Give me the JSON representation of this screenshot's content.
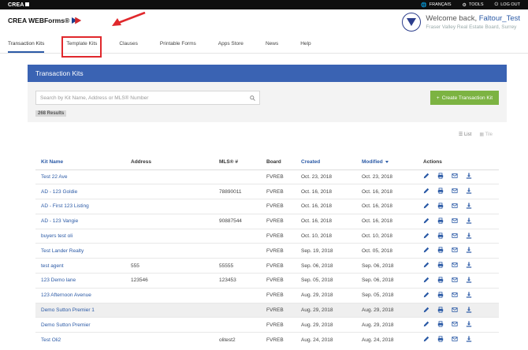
{
  "topbar": {
    "logo": "CREA",
    "links": [
      {
        "icon": "globe-icon",
        "label": "FRANÇAIS"
      },
      {
        "icon": "gear-icon",
        "label": "TOOLS"
      },
      {
        "icon": "power-icon",
        "label": "LOG OUT"
      }
    ]
  },
  "header": {
    "brand": "CREA WEBForms®",
    "welcome_prefix": "Welcome back, ",
    "username": "Faltour_Test",
    "board": "Fraser Valley Real Estate Board, Surrey"
  },
  "nav": [
    {
      "label": "Transaction Kits",
      "active": true
    },
    {
      "label": "Template Kits",
      "highlighted": true
    },
    {
      "label": "Clauses"
    },
    {
      "label": "Printable Forms"
    },
    {
      "label": "Apps Store"
    },
    {
      "label": "News"
    },
    {
      "label": "Help"
    }
  ],
  "panel": {
    "title": "Transaction Kits",
    "search_placeholder": "Search by Kit Name, Address or MLS® Number",
    "create_label": "Create Transaction Kit",
    "results": "268 Results",
    "view_list": "List",
    "view_tile": "Tile"
  },
  "table": {
    "headers": [
      "Kit Name",
      "Address",
      "MLS® #",
      "Board",
      "Created",
      "Modified",
      "Actions"
    ],
    "rows": [
      {
        "kit": "Test 22 Ave",
        "address": "",
        "mls": "",
        "board": "FVREB",
        "created": "Oct. 23, 2018",
        "modified": "Oct. 23, 2018"
      },
      {
        "kit": "AD - 123 Goldie",
        "address": "",
        "mls": "78890011",
        "board": "FVREB",
        "created": "Oct. 16, 2018",
        "modified": "Oct. 16, 2018"
      },
      {
        "kit": "AD - First 123 Listing",
        "address": "",
        "mls": "",
        "board": "FVREB",
        "created": "Oct. 16, 2018",
        "modified": "Oct. 16, 2018"
      },
      {
        "kit": "AD - 123 Vangie",
        "address": "",
        "mls": "90887544",
        "board": "FVREB",
        "created": "Oct. 16, 2018",
        "modified": "Oct. 16, 2018"
      },
      {
        "kit": "buyers test oli",
        "address": "",
        "mls": "",
        "board": "FVREB",
        "created": "Oct. 10, 2018",
        "modified": "Oct. 10, 2018"
      },
      {
        "kit": "Test Lander Realty",
        "address": "",
        "mls": "",
        "board": "FVREB",
        "created": "Sep. 19, 2018",
        "modified": "Oct. 05, 2018"
      },
      {
        "kit": "test agent",
        "address": "555",
        "mls": "55555",
        "board": "FVREB",
        "created": "Sep. 06, 2018",
        "modified": "Sep. 06, 2018"
      },
      {
        "kit": "123 Demo lane",
        "address": "123546",
        "mls": "123453",
        "board": "FVREB",
        "created": "Sep. 05, 2018",
        "modified": "Sep. 06, 2018"
      },
      {
        "kit": "123 Afternoon Avenue",
        "address": "",
        "mls": "",
        "board": "FVREB",
        "created": "Aug. 29, 2018",
        "modified": "Sep. 05, 2018"
      },
      {
        "kit": "Demo Sutton Premier 1",
        "address": "",
        "mls": "",
        "board": "FVREB",
        "created": "Aug. 29, 2018",
        "modified": "Aug. 29, 2018",
        "shade": true
      },
      {
        "kit": "Demo Sutton Premier",
        "address": "",
        "mls": "",
        "board": "FVREB",
        "created": "Aug. 29, 2018",
        "modified": "Aug. 29, 2018"
      },
      {
        "kit": "Test Oli2",
        "address": "",
        "mls": "olitest2",
        "board": "FVREB",
        "created": "Aug. 24, 2018",
        "modified": "Aug. 24, 2018"
      }
    ]
  }
}
